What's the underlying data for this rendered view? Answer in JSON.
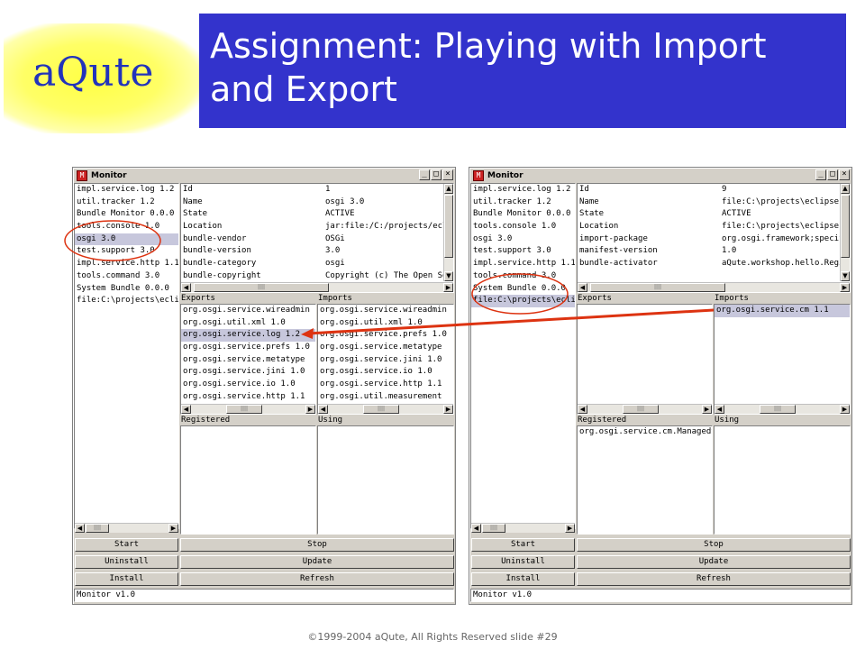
{
  "slide": {
    "logo_text": "aQute",
    "title": "Assignment: Playing with Import and Export",
    "footer": "©1999-2004 aQute, All Rights Reserved slide #29"
  },
  "windows": [
    {
      "title": "Monitor",
      "bundles": [
        "impl.service.log 1.2",
        "util.tracker 1.2",
        "Bundle Monitor 0.0.0",
        "tools.console 1.0",
        "osgi 3.0",
        "test.support 3.0",
        "impl.service.http 1.1",
        "tools.command 3.0",
        "System Bundle 0.0.0",
        "file:C:\\projects\\eclipse"
      ],
      "selected_bundle": 4,
      "properties": [
        {
          "key": "Id",
          "value": "1"
        },
        {
          "key": "Name",
          "value": "osgi 3.0"
        },
        {
          "key": "State",
          "value": "ACTIVE"
        },
        {
          "key": "Location",
          "value": "jar:file:/C:/projects/eclipse"
        },
        {
          "key": "bundle-vendor",
          "value": "OSGi"
        },
        {
          "key": "bundle-version",
          "value": "3.0"
        },
        {
          "key": "bundle-category",
          "value": "osgi"
        },
        {
          "key": "bundle-copyright",
          "value": "Copyright (c) The Open Source"
        }
      ],
      "exports_label": "Exports",
      "imports_label": "Imports",
      "exports": [
        "org.osgi.service.wireadmin",
        "org.osgi.util.xml 1.0",
        "org.osgi.service.log 1.2",
        "org.osgi.service.prefs 1.0",
        "org.osgi.service.metatype",
        "org.osgi.service.jini 1.0",
        "org.osgi.service.io 1.0",
        "org.osgi.service.http 1.1"
      ],
      "selected_export": 2,
      "imports": [
        "org.osgi.service.wireadmin",
        "org.osgi.util.xml 1.0",
        "org.osgi.service.prefs 1.0",
        "org.osgi.service.metatype",
        "org.osgi.service.jini 1.0",
        "org.osgi.service.io 1.0",
        "org.osgi.service.http 1.1",
        "org.osgi.util.measurement"
      ],
      "selected_import": -1,
      "registered_label": "Registered",
      "using_label": "Using",
      "registered": [],
      "using": [],
      "buttons": {
        "start": "Start",
        "stop": "Stop",
        "uninstall": "Uninstall",
        "update": "Update",
        "install": "Install",
        "refresh": "Refresh"
      },
      "status": "Monitor v1.0"
    },
    {
      "title": "Monitor",
      "bundles": [
        "impl.service.log 1.2",
        "util.tracker 1.2",
        "Bundle Monitor 0.0.0",
        "tools.console 1.0",
        "osgi 3.0",
        "test.support 3.0",
        "impl.service.http 1.1",
        "tools.command 3.0",
        "System Bundle 0.0.0",
        "file:C:\\projects\\eclipse"
      ],
      "selected_bundle": 9,
      "properties": [
        {
          "key": "Id",
          "value": "9"
        },
        {
          "key": "Name",
          "value": "file:C:\\projects\\eclipse-aQute"
        },
        {
          "key": "State",
          "value": "ACTIVE"
        },
        {
          "key": "Location",
          "value": "file:C:\\projects\\eclipse-aQute"
        },
        {
          "key": "import-package",
          "value": "org.osgi.framework;specification"
        },
        {
          "key": "manifest-version",
          "value": "1.0"
        },
        {
          "key": "bundle-activator",
          "value": "aQute.workshop.hello.Register"
        }
      ],
      "exports_label": "Exports",
      "imports_label": "Imports",
      "exports": [],
      "selected_export": -1,
      "imports": [
        "org.osgi.service.cm 1.1"
      ],
      "selected_import": 0,
      "registered_label": "Registered",
      "using_label": "Using",
      "registered": [
        "org.osgi.service.cm.ManagedService"
      ],
      "using": [],
      "buttons": {
        "start": "Start",
        "stop": "Stop",
        "uninstall": "Uninstall",
        "update": "Update",
        "install": "Install",
        "refresh": "Refresh"
      },
      "status": "Monitor v1.0"
    }
  ],
  "annotations": {
    "highlight_color": "#dd3311"
  }
}
